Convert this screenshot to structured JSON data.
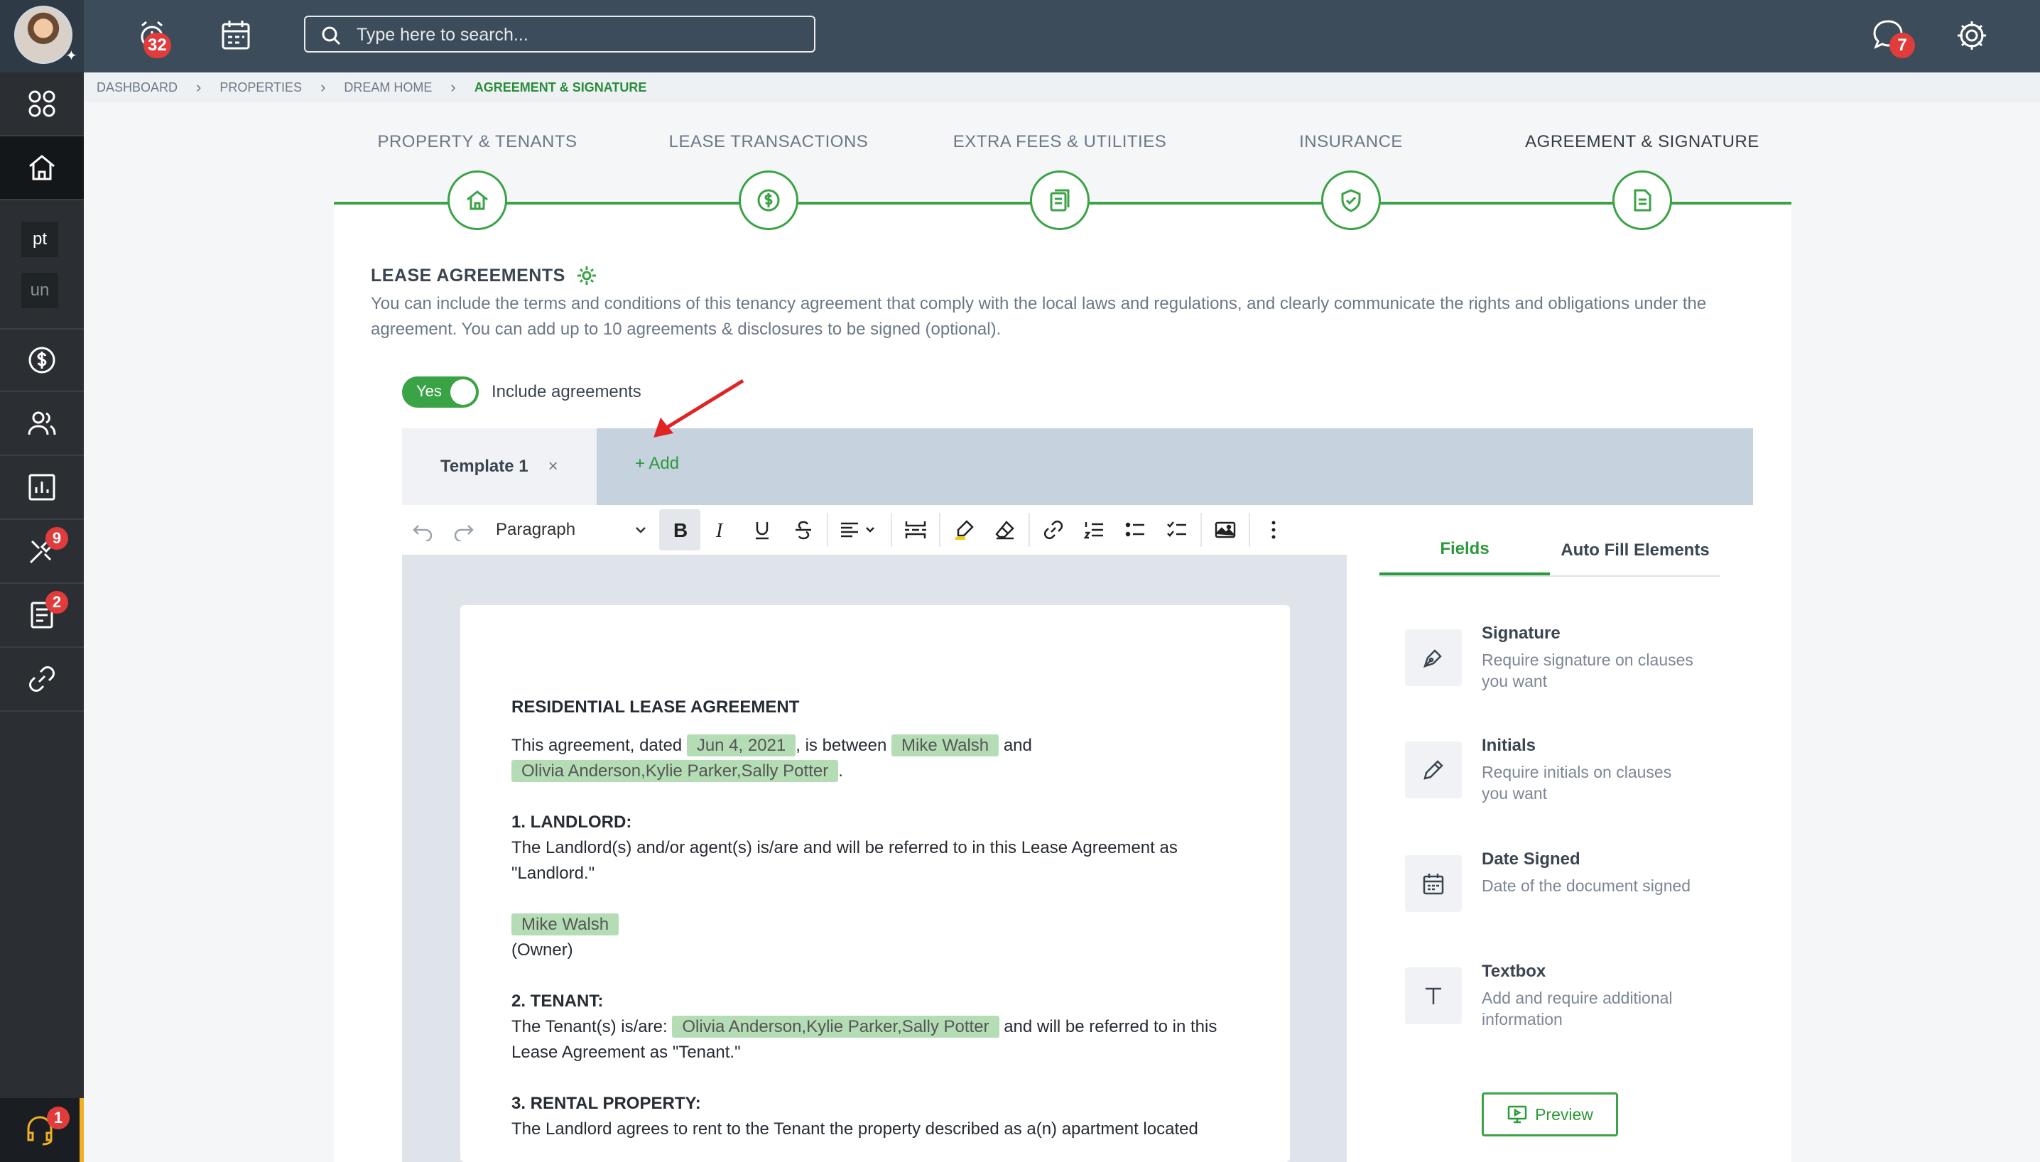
{
  "topbar": {
    "search_placeholder": "Type here to search...",
    "alarm_badge": "32",
    "chat_badge": "7"
  },
  "sidebar": {
    "text_items": [
      "pt",
      "un"
    ],
    "tools_badge": "9",
    "docs_badge": "2",
    "support_badge": "1"
  },
  "breadcrumb": [
    "DASHBOARD",
    "PROPERTIES",
    "DREAM HOME",
    "AGREEMENT & SIGNATURE"
  ],
  "steps": [
    {
      "label": "PROPERTY & TENANTS",
      "icon": "house-icon"
    },
    {
      "label": "LEASE TRANSACTIONS",
      "icon": "dollar-icon"
    },
    {
      "label": "EXTRA FEES & UTILITIES",
      "icon": "bills-icon"
    },
    {
      "label": "INSURANCE",
      "icon": "shield-icon"
    },
    {
      "label": "AGREEMENT & SIGNATURE",
      "icon": "document-icon"
    }
  ],
  "section": {
    "title": "LEASE AGREEMENTS",
    "description": "You can include the terms and conditions of this tenancy agreement that comply with the local laws and regulations, and clearly communicate the rights and obligations under the agreement. You can add up to 10 agreements & disclosures to be signed (optional).",
    "toggle_label": "Yes",
    "include_label": "Include agreements"
  },
  "tabs": {
    "active": "Template 1",
    "close": "×",
    "add": "+ Add"
  },
  "toolbar": {
    "paragraph": "Paragraph"
  },
  "document": {
    "title": "RESIDENTIAL LEASE AGREEMENT",
    "intro_1": "This agreement, dated",
    "date": "Jun 4, 2021",
    "intro_2": ", is between",
    "landlord": "Mike Walsh",
    "intro_3": "and",
    "tenants": "Olivia Anderson,Kylie Parker,Sally Potter",
    "period": ".",
    "s1_title": "1. LANDLORD:",
    "s1_text": "The Landlord(s) and/or agent(s) is/are and will be referred to in this Lease Agreement as \"Landlord.\"",
    "s1_name": "Mike Walsh",
    "s1_role": "(Owner)",
    "s2_title": "2. TENANT:",
    "s2_pre": "The Tenant(s) is/are:",
    "s2_names": "Olivia Anderson,Kylie Parker,Sally Potter",
    "s2_post": "and will be referred to in this Lease Agreement as \"Tenant.\"",
    "s3_title": "3. RENTAL PROPERTY:",
    "s3_text": "The Landlord agrees to rent to the Tenant the property described as a(n) apartment located"
  },
  "right_panel": {
    "tabs": [
      "Fields",
      "Auto Fill Elements"
    ],
    "fields": [
      {
        "title": "Signature",
        "desc": "Require signature on clauses you want",
        "icon": "pen-icon"
      },
      {
        "title": "Initials",
        "desc": "Require initials on clauses you want",
        "icon": "pencil-icon"
      },
      {
        "title": "Date Signed",
        "desc": "Date of the document signed",
        "icon": "calendar-icon"
      },
      {
        "title": "Textbox",
        "desc": "Add and require additional information",
        "icon": "text-icon"
      }
    ],
    "preview_label": "Preview"
  },
  "colors": {
    "accent": "#3aa346",
    "topbar": "#3d4c5a",
    "sidebar": "#2b2f33",
    "badge": "#e03c3c",
    "chip": "#b5ddb5",
    "arrow": "#e02424"
  }
}
